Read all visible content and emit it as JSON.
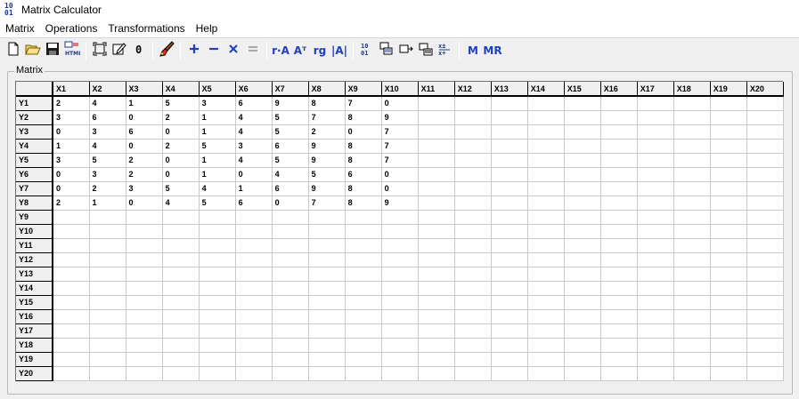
{
  "window": {
    "title": "Matrix Calculator",
    "icon": "matrix-app-icon"
  },
  "menu": [
    "Matrix",
    "Operations",
    "Transformations",
    "Help"
  ],
  "toolbar": {
    "groups": [
      [
        {
          "name": "new-file-icon",
          "symbol": "new"
        },
        {
          "name": "open-folder-icon",
          "symbol": "open"
        },
        {
          "name": "save-icon",
          "symbol": "save"
        },
        {
          "name": "export-html-icon",
          "symbol": "html"
        }
      ],
      [
        {
          "name": "resize-matrix-icon",
          "symbol": "resize"
        },
        {
          "name": "edit-matrix-icon",
          "symbol": "edit"
        },
        {
          "name": "zero-matrix-icon",
          "symbol": "zero"
        }
      ],
      [
        {
          "name": "clear-brush-icon",
          "symbol": "brush"
        }
      ],
      [
        {
          "name": "add-icon",
          "symbol": "+"
        },
        {
          "name": "subtract-icon",
          "symbol": "−"
        },
        {
          "name": "multiply-icon",
          "symbol": "×"
        },
        {
          "name": "equals-icon",
          "symbol": "="
        }
      ],
      [
        {
          "name": "scalar-multiply-icon",
          "text": "r·A"
        },
        {
          "name": "transpose-icon",
          "text": "Aᵀ"
        },
        {
          "name": "rank-icon",
          "text": "rg"
        },
        {
          "name": "determinant-icon",
          "text": "|A|"
        }
      ],
      [
        {
          "name": "swap-rows-icon",
          "symbol": "swap"
        },
        {
          "name": "copy-matrix-icon",
          "symbol": "copy"
        },
        {
          "name": "move-icon",
          "symbol": "move"
        },
        {
          "name": "paste-matrix-icon",
          "symbol": "paste"
        },
        {
          "name": "divide-icon",
          "symbol": "div"
        }
      ],
      [
        {
          "name": "memory-icon",
          "text": "M"
        },
        {
          "name": "memory-recall-icon",
          "text": "MR"
        }
      ]
    ]
  },
  "matrix": {
    "label": "Matrix",
    "columns": [
      "X1",
      "X2",
      "X3",
      "X4",
      "X5",
      "X6",
      "X7",
      "X8",
      "X9",
      "X10",
      "X11",
      "X12",
      "X13",
      "X14",
      "X15",
      "X16",
      "X17",
      "X18",
      "X19",
      "X20"
    ],
    "rows": [
      "Y1",
      "Y2",
      "Y3",
      "Y4",
      "Y5",
      "Y6",
      "Y7",
      "Y8",
      "Y9",
      "Y10",
      "Y11",
      "Y12",
      "Y13",
      "Y14",
      "Y15",
      "Y16",
      "Y17",
      "Y18",
      "Y19",
      "Y20"
    ],
    "values": [
      [
        "2",
        "4",
        "1",
        "5",
        "3",
        "6",
        "9",
        "8",
        "7",
        "0"
      ],
      [
        "3",
        "6",
        "0",
        "2",
        "1",
        "4",
        "5",
        "7",
        "8",
        "9"
      ],
      [
        "0",
        "3",
        "6",
        "0",
        "1",
        "4",
        "5",
        "2",
        "0",
        "7"
      ],
      [
        "1",
        "4",
        "0",
        "2",
        "5",
        "3",
        "6",
        "9",
        "8",
        "7"
      ],
      [
        "3",
        "5",
        "2",
        "0",
        "1",
        "4",
        "5",
        "9",
        "8",
        "7"
      ],
      [
        "0",
        "3",
        "2",
        "0",
        "1",
        "0",
        "4",
        "5",
        "6",
        "0"
      ],
      [
        "0",
        "2",
        "3",
        "5",
        "4",
        "1",
        "6",
        "9",
        "8",
        "0"
      ],
      [
        "2",
        "1",
        "0",
        "4",
        "5",
        "6",
        "0",
        "7",
        "8",
        "9"
      ]
    ]
  }
}
